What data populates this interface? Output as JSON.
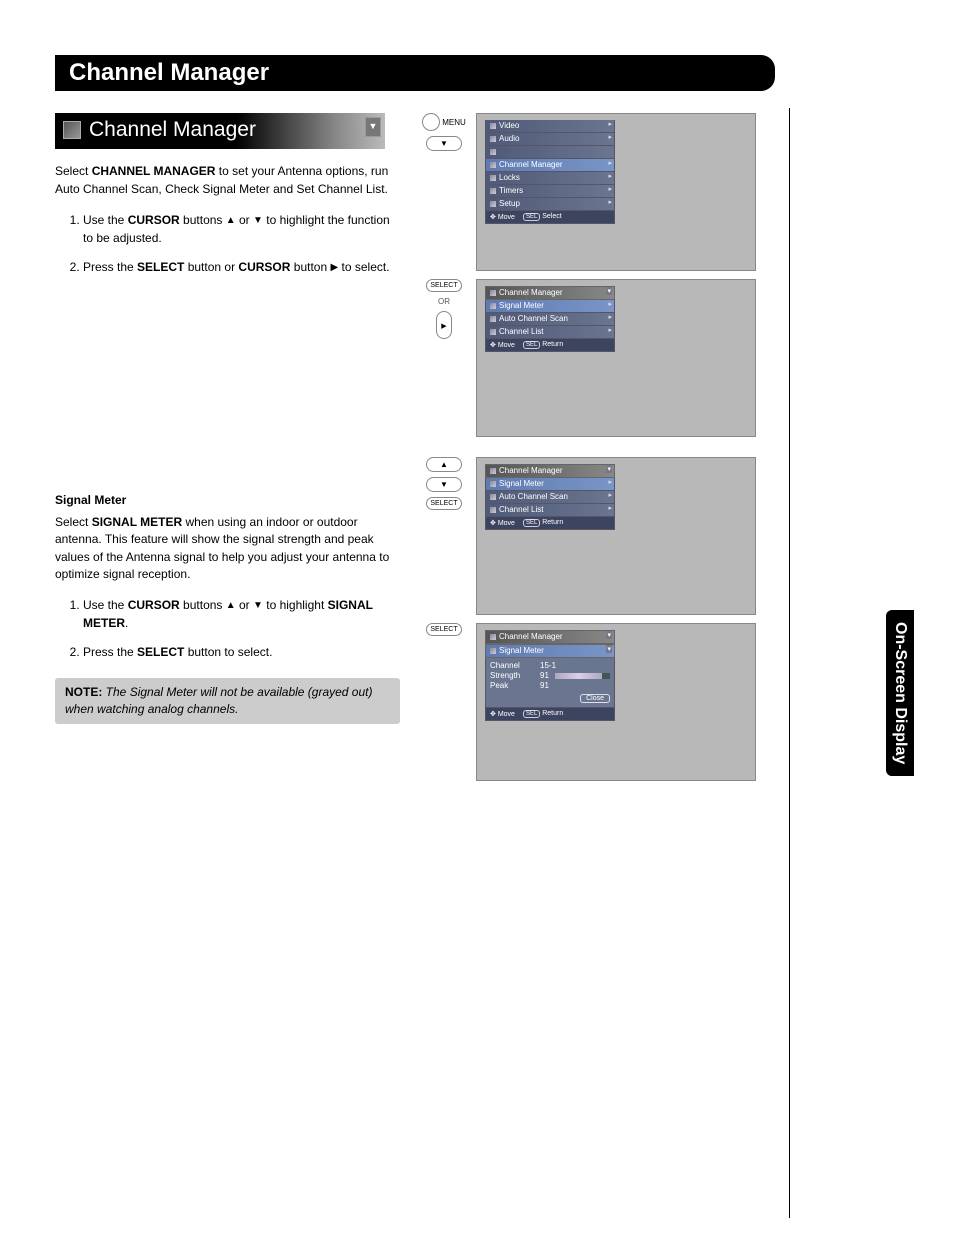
{
  "page_title": "Channel Manager",
  "sub_title": "Channel Manager",
  "side_tab": "On-Screen Display",
  "intro": {
    "prefix": "Select ",
    "bold1": "CHANNEL MANAGER",
    "suffix": " to set your Antenna options, run Auto Channel Scan, Check Signal Meter and Set Channel List."
  },
  "steps1": {
    "s1a": "Use the ",
    "s1b": "CURSOR",
    "s1c": " buttons ",
    "s1d": " or ",
    "s1e": " to highlight the function to be adjusted.",
    "s2a": "Press the ",
    "s2b": "SELECT",
    "s2c": " button or ",
    "s2d": "CURSOR",
    "s2e": " button ",
    "s2f": " to select."
  },
  "section2_heading": "Signal Meter",
  "section2_body": {
    "a": "Select ",
    "b": "SIGNAL METER",
    "c": " when using an indoor or outdoor antenna. This feature will show the signal strength and peak values of the Antenna signal to help you adjust your antenna to optimize signal reception."
  },
  "steps2": {
    "s1a": "Use the ",
    "s1b": "CURSOR",
    "s1c": " buttons ",
    "s1d": " or ",
    "s1e": " to highlight ",
    "s1f": "SIGNAL METER",
    "s1g": ".",
    "s2a": "Press the ",
    "s2b": "SELECT",
    "s2c": " button to select."
  },
  "note": {
    "label": "NOTE:",
    "text": " The Signal Meter will not be available (grayed out) when watching analog channels."
  },
  "remote": {
    "menu": "MENU",
    "select": "SELECT",
    "or": "OR"
  },
  "osd": {
    "main_menu": {
      "items": [
        "Video",
        "Audio",
        "",
        "Channel Manager",
        "Locks",
        "Timers",
        "Setup"
      ],
      "footer_move": "Move",
      "footer_sel": "SEL",
      "footer_select": "Select"
    },
    "cm_menu": {
      "header": "Channel Manager",
      "items": [
        "Signal Meter",
        "Auto Channel Scan",
        "Channel List"
      ],
      "footer_move": "Move",
      "footer_sel": "SEL",
      "footer_return": "Return"
    },
    "signal_detail": {
      "header1": "Channel Manager",
      "header2": "Signal Meter",
      "rows": [
        {
          "label": "Channel",
          "value": "15-1"
        },
        {
          "label": "Strength",
          "value": "91"
        },
        {
          "label": "Peak",
          "value": "91"
        }
      ],
      "close": "Close",
      "footer_move": "Move",
      "footer_sel": "SEL",
      "footer_return": "Return"
    }
  }
}
